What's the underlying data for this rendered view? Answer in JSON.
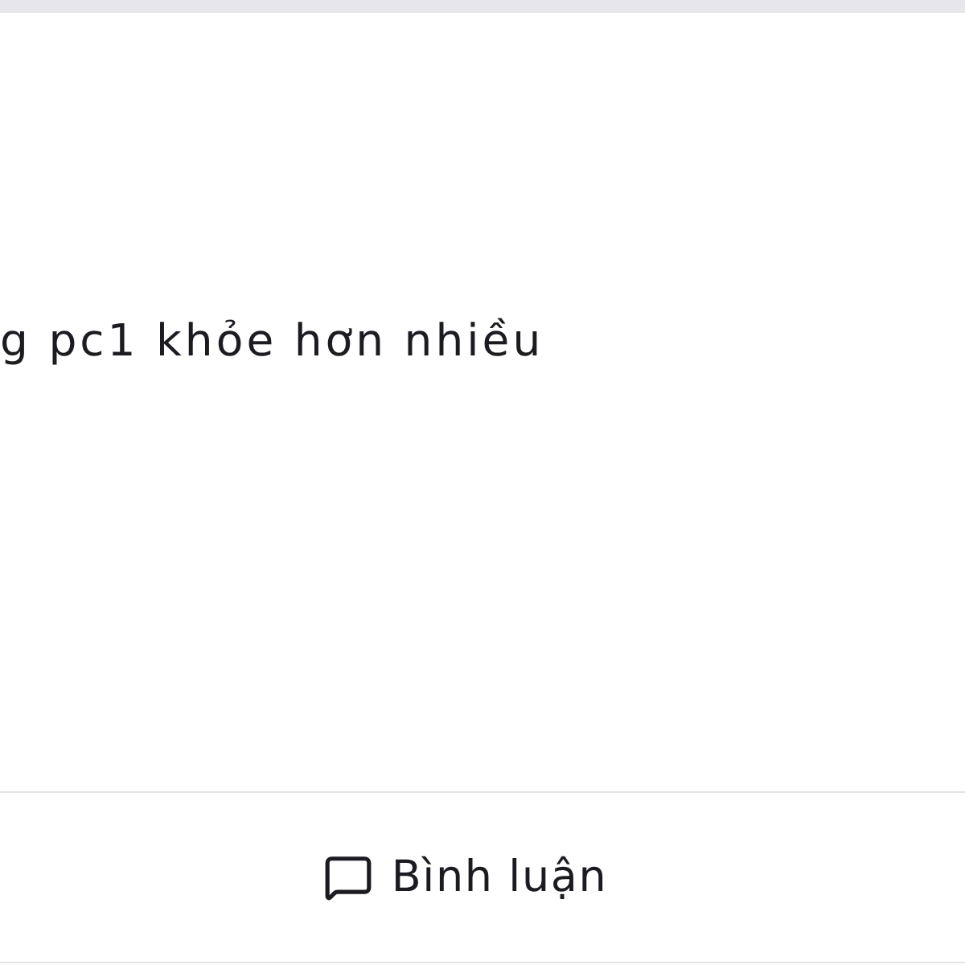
{
  "post": {
    "text": "g pc1 khỏe hơn nhiều"
  },
  "actions": [
    {
      "kind": "comment",
      "label": "Bình luận"
    }
  ]
}
